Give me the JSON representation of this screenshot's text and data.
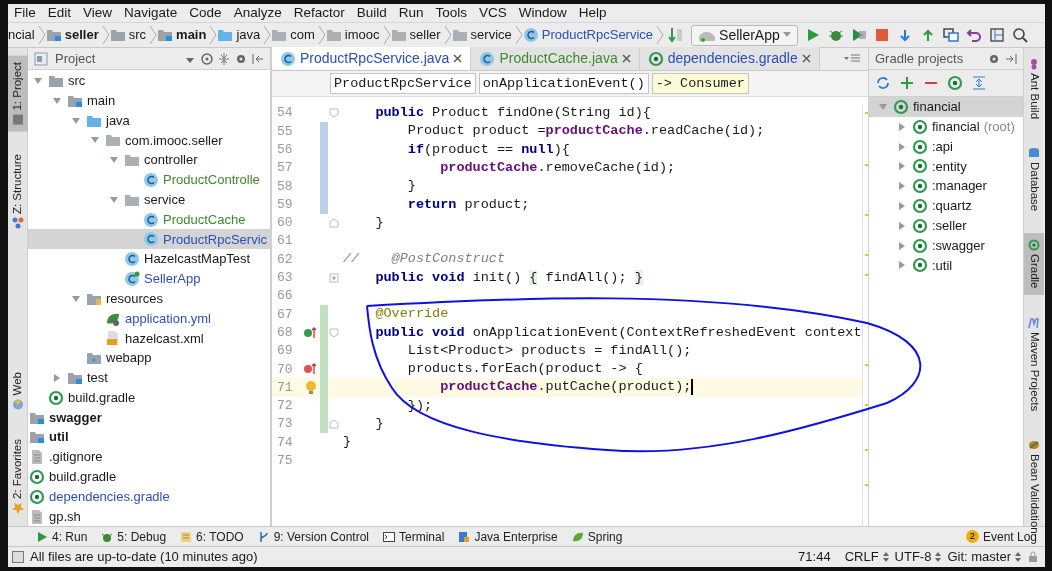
{
  "menu": [
    "File",
    "Edit",
    "View",
    "Navigate",
    "Code",
    "Analyze",
    "Refactor",
    "Build",
    "Run",
    "Tools",
    "VCS",
    "Window",
    "Help"
  ],
  "nav_breadcrumbs": [
    {
      "label": "ncial",
      "kind": "plain"
    },
    {
      "label": "seller",
      "kind": "module"
    },
    {
      "label": "src",
      "kind": "folder"
    },
    {
      "label": "main",
      "kind": "source-root"
    },
    {
      "label": "java",
      "kind": "java-folder"
    },
    {
      "label": "com",
      "kind": "package"
    },
    {
      "label": "imooc",
      "kind": "package"
    },
    {
      "label": "seller",
      "kind": "package"
    },
    {
      "label": "service",
      "kind": "package"
    },
    {
      "label": "ProductRpcService",
      "kind": "class"
    }
  ],
  "run_config": "SellerApp",
  "left_strip": {
    "top": [
      {
        "label": "1: Project",
        "kind": "project",
        "selected": true
      },
      {
        "label": "Z: Structure",
        "kind": "structure",
        "selected": false
      }
    ],
    "bottom": [
      {
        "label": "Web",
        "kind": "web",
        "selected": false
      },
      {
        "label": "2: Favorites",
        "kind": "favorites",
        "selected": false
      }
    ]
  },
  "project_panel": {
    "title": "Project",
    "tree": [
      {
        "children": [
          {
            "label": "src",
            "kind": "folder",
            "expanded": true,
            "selected": false,
            "children": [
              {
                "label": "main",
                "kind": "source-root",
                "expanded": true,
                "selected": false,
                "children": [
                  {
                    "label": "java",
                    "kind": "java-folder",
                    "expanded": true,
                    "selected": false,
                    "children": [
                      {
                        "label": "com.imooc.seller",
                        "kind": "package",
                        "expanded": true,
                        "selected": false,
                        "children": [
                          {
                            "label": "controller",
                            "kind": "package",
                            "expanded": true,
                            "selected": false,
                            "children": [
                              {
                                "label": "ProductControlle",
                                "kind": "class",
                                "color": "#3e8a2c",
                                "selected": false
                              }
                            ]
                          },
                          {
                            "label": "service",
                            "kind": "package",
                            "expanded": true,
                            "selected": false,
                            "children": [
                              {
                                "label": "ProductCache",
                                "kind": "class",
                                "color": "#3e8a2c",
                                "selected": false
                              },
                              {
                                "label": "ProductRpcServic",
                                "kind": "class",
                                "color": "#2b4fb5",
                                "selected": true
                              }
                            ]
                          },
                          {
                            "label": "HazelcastMapTest",
                            "kind": "class",
                            "selected": false
                          },
                          {
                            "label": "SellerApp",
                            "kind": "app-class",
                            "color": "#2b4fb5",
                            "selected": false
                          }
                        ]
                      }
                    ]
                  },
                  {
                    "label": "resources",
                    "kind": "resources-folder",
                    "expanded": true,
                    "selected": false,
                    "children": [
                      {
                        "label": "application.yml",
                        "kind": "yml",
                        "color": "#2b4fb5",
                        "selected": false
                      },
                      {
                        "label": "hazelcast.xml",
                        "kind": "xml",
                        "selected": false
                      }
                    ]
                  },
                  {
                    "label": "webapp",
                    "kind": "web-folder",
                    "selected": false
                  }
                ]
              },
              {
                "label": "test",
                "kind": "source-root",
                "expanded": false,
                "selected": false
              }
            ]
          },
          {
            "label": "build.gradle",
            "kind": "gradle",
            "selected": false
          }
        ]
      },
      {
        "label": "swagger",
        "kind": "module",
        "selected": false
      },
      {
        "label": "util",
        "kind": "module",
        "selected": false
      },
      {
        "label": ".gitignore",
        "kind": "file",
        "selected": false
      },
      {
        "label": "build.gradle",
        "kind": "gradle",
        "selected": false
      },
      {
        "label": "dependencies.gradle",
        "kind": "gradle",
        "color": "#2b4fb5",
        "selected": false
      },
      {
        "label": "gp.sh",
        "kind": "file",
        "selected": false
      }
    ]
  },
  "editor": {
    "tabs": [
      {
        "label": "ProductRpcService.java",
        "kind": "class",
        "color": "#2b4fb5",
        "selected": true
      },
      {
        "label": "ProductCache.java",
        "kind": "class",
        "color": "#3e8a2c",
        "selected": false
      },
      {
        "label": "dependencies.gradle",
        "kind": "gradle",
        "color": "#2b4fb5",
        "selected": false
      }
    ],
    "breadcrumbs": [
      {
        "label": "ProductRpcService",
        "selected": false
      },
      {
        "label": "onApplicationEvent()",
        "selected": false
      },
      {
        "label": "-> Consumer",
        "selected": true
      }
    ],
    "lines": [
      {
        "number": "54",
        "current": false,
        "fold": {
          "kind": "start"
        },
        "segments": [
          {
            "text": "    public",
            "kind": "keyword"
          },
          {
            "text": " Product findOne(String id){",
            "kind": "plain"
          }
        ]
      },
      {
        "number": "55",
        "current": false,
        "change": {
          "color": "#b9d0ec"
        },
        "segments": [
          {
            "text": "        Product product =",
            "kind": "plain"
          },
          {
            "text": "productCache",
            "kind": "field"
          },
          {
            "text": ".readCache(id);",
            "kind": "plain"
          }
        ]
      },
      {
        "number": "56",
        "current": false,
        "change": {
          "color": "#b9d0ec"
        },
        "segments": [
          {
            "text": "        if",
            "kind": "keyword"
          },
          {
            "text": "(product == ",
            "kind": "plain"
          },
          {
            "text": "null",
            "kind": "keyword"
          },
          {
            "text": "){",
            "kind": "plain"
          }
        ]
      },
      {
        "number": "57",
        "current": false,
        "change": {
          "color": "#b9d0ec"
        },
        "segments": [
          {
            "text": "            productCache",
            "kind": "field"
          },
          {
            "text": ".removeCache(id);",
            "kind": "plain"
          }
        ]
      },
      {
        "number": "58",
        "current": false,
        "change": {
          "color": "#b9d0ec"
        },
        "segments": [
          {
            "text": "        }",
            "kind": "plain"
          }
        ]
      },
      {
        "number": "59",
        "current": false,
        "change": {
          "color": "#b9d0ec"
        },
        "segments": [
          {
            "text": "        return",
            "kind": "keyword"
          },
          {
            "text": " product;",
            "kind": "plain"
          }
        ]
      },
      {
        "number": "60",
        "current": false,
        "fold": {
          "kind": "end"
        },
        "segments": [
          {
            "text": "    }",
            "kind": "plain"
          }
        ]
      },
      {
        "number": "61",
        "current": false
      },
      {
        "number": "62",
        "current": false,
        "segments": [
          {
            "text": "//    @PostConstruct",
            "kind": "comment"
          }
        ]
      },
      {
        "number": "63",
        "current": false,
        "fold": {
          "kind": "collapsed"
        },
        "segments": [
          {
            "text": "    public void",
            "kind": "keyword"
          },
          {
            "text": " init() ",
            "kind": "plain"
          },
          {
            "text": "{",
            "kind": "folded"
          },
          {
            "text": " findAll(); ",
            "kind": "plain"
          },
          {
            "text": "}",
            "kind": "folded"
          }
        ]
      },
      {
        "number": "66",
        "current": false
      },
      {
        "number": "67",
        "current": false,
        "change": {
          "color": "#c2dfc0"
        },
        "segments": [
          {
            "text": "    @Override",
            "kind": "annotation"
          }
        ]
      },
      {
        "number": "68",
        "current": false,
        "change": {
          "color": "#c2dfc0"
        },
        "fold": {
          "kind": "start"
        },
        "gutter": {
          "kind": "implements"
        },
        "segments": [
          {
            "text": "    public void",
            "kind": "keyword"
          },
          {
            "text": " onApplicationEvent(ContextRefreshedEvent context",
            "kind": "plain"
          }
        ]
      },
      {
        "number": "69",
        "current": false,
        "change": {
          "color": "#c2dfc0"
        },
        "segments": [
          {
            "text": "        List<Product> products = findAll();",
            "kind": "plain"
          }
        ]
      },
      {
        "number": "70",
        "current": false,
        "change": {
          "color": "#c2dfc0"
        },
        "gutter": {
          "kind": "recursion"
        },
        "segments": [
          {
            "text": "        products.forEach(product -> {",
            "kind": "plain"
          }
        ]
      },
      {
        "number": "71",
        "current": true,
        "change": {
          "color": "#c2dfc0"
        },
        "gutter": {
          "kind": "bulb"
        },
        "segments": [
          {
            "text": "            productCache",
            "kind": "field"
          },
          {
            "text": ".putCache(product);",
            "kind": "plain"
          }
        ]
      },
      {
        "number": "72",
        "current": false,
        "change": {
          "color": "#c2dfc0"
        },
        "segments": [
          {
            "text": "        });",
            "kind": "plain"
          }
        ]
      },
      {
        "number": "73",
        "current": false,
        "change": {
          "color": "#c2dfc0"
        },
        "fold": {
          "kind": "end"
        },
        "segments": [
          {
            "text": "    }",
            "kind": "plain"
          }
        ]
      },
      {
        "number": "74",
        "current": false,
        "segments": [
          {
            "text": "}",
            "kind": "plain"
          }
        ]
      },
      {
        "number": "75",
        "current": false
      }
    ]
  },
  "gradle_panel": {
    "title": "Gradle projects",
    "tree": [
      {
        "label": "financial",
        "expanded": true,
        "selected": true,
        "children": [
          {
            "label": "financial",
            "note": "(root)",
            "expanded": false,
            "selected": false
          },
          {
            "label": ":api",
            "expanded": false,
            "selected": false
          },
          {
            "label": ":entity",
            "expanded": false,
            "selected": false
          },
          {
            "label": ":manager",
            "expanded": false,
            "selected": false
          },
          {
            "label": ":quartz",
            "expanded": false,
            "selected": false
          },
          {
            "label": ":seller",
            "expanded": false,
            "selected": false
          },
          {
            "label": ":swagger",
            "expanded": false,
            "selected": false
          },
          {
            "label": ":util",
            "expanded": false,
            "selected": false
          }
        ]
      }
    ]
  },
  "right_strip": [
    {
      "label": "Ant Build",
      "kind": "ant",
      "selected": false
    },
    {
      "label": "Database",
      "kind": "database",
      "selected": false
    },
    {
      "label": "Gradle",
      "kind": "gradle",
      "selected": true
    },
    {
      "label": "Maven Projects",
      "kind": "maven",
      "selected": false
    },
    {
      "label": "Bean Validation",
      "kind": "bean",
      "selected": false
    }
  ],
  "tool_windows": [
    {
      "label": "4: Run",
      "kind": "run"
    },
    {
      "label": "5: Debug",
      "kind": "debug"
    },
    {
      "label": "6: TODO",
      "kind": "todo"
    },
    {
      "label": "9: Version Control",
      "kind": "vcs"
    },
    {
      "label": "Terminal",
      "kind": "terminal"
    },
    {
      "label": "Java Enterprise",
      "kind": "enterprise"
    },
    {
      "label": "Spring",
      "kind": "spring"
    }
  ],
  "event_log": {
    "label": "Event Log",
    "count": "2"
  },
  "status_bar": {
    "message": "All files are up-to-date (10 minutes ago)",
    "position": "71:44",
    "line_separator": "CRLF",
    "encoding": "UTF-8",
    "vcs_branch": "Git: master"
  }
}
